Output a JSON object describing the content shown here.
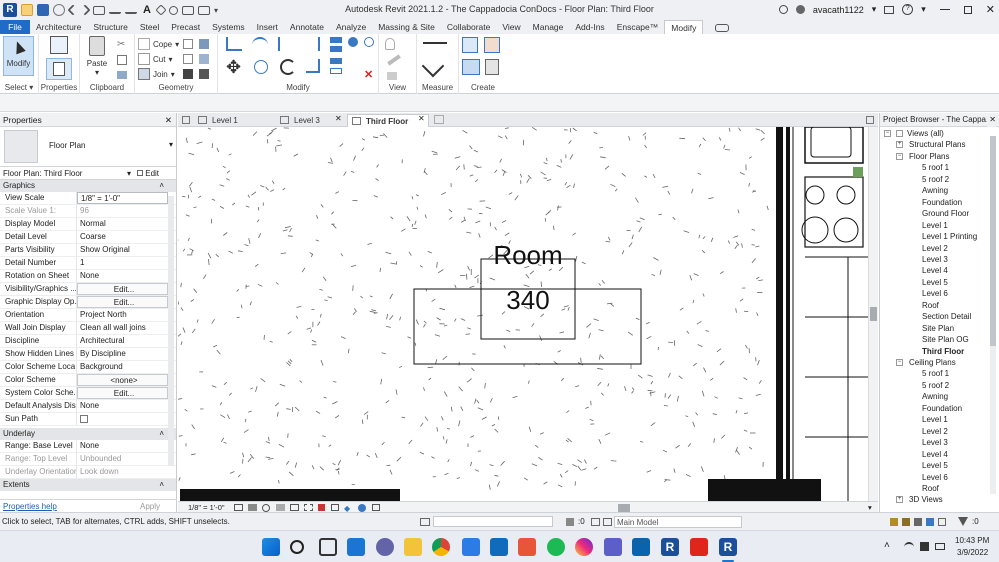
{
  "window": {
    "app_title": "Autodesk Revit 2021.1.2 - The Cappadocia ConDocs - Floor Plan: Third Floor",
    "username": "avacath1122",
    "help_glyph": "?"
  },
  "ribbon_tabs": [
    "File",
    "Architecture",
    "Structure",
    "Steel",
    "Precast",
    "Systems",
    "Insert",
    "Annotate",
    "Analyze",
    "Massing & Site",
    "Collaborate",
    "View",
    "Manage",
    "Add-Ins",
    "Enscape™",
    "Modify"
  ],
  "active_tab": "Modify",
  "ribbon": {
    "modify_label": "Modify",
    "select_label": "Select",
    "select_caret": "▾",
    "properties_label": "Properties",
    "paste_label": "Paste",
    "clipboard_label": "Clipboard",
    "cope_label": "Cope",
    "cut_label": "Cut",
    "join_label": "Join",
    "geometry_label": "Geometry",
    "modify_panel_label": "Modify",
    "view_label": "View",
    "measure_label": "Measure",
    "create_label": "Create"
  },
  "properties": {
    "header": "Properties",
    "close_glyph": "✕",
    "type_name": "Floor Plan",
    "selector": "Floor Plan: Third Floor",
    "edit_type": "Edit Type",
    "group_graphics": "Graphics",
    "group_underlay": "Underlay",
    "group_extents": "Extents",
    "rows": [
      {
        "k": "View Scale",
        "v": "1/8\" = 1'-0\""
      },
      {
        "k": "Scale Value    1:",
        "v": "96"
      },
      {
        "k": "Display Model",
        "v": "Normal"
      },
      {
        "k": "Detail Level",
        "v": "Coarse"
      },
      {
        "k": "Parts Visibility",
        "v": "Show Original"
      },
      {
        "k": "Detail Number",
        "v": "1"
      },
      {
        "k": "Rotation on Sheet",
        "v": "None"
      },
      {
        "k": "Visibility/Graphics ...",
        "v": "Edit..."
      },
      {
        "k": "Graphic Display Op...",
        "v": "Edit..."
      },
      {
        "k": "Orientation",
        "v": "Project North"
      },
      {
        "k": "Wall Join Display",
        "v": "Clean all wall joins"
      },
      {
        "k": "Discipline",
        "v": "Architectural"
      },
      {
        "k": "Show Hidden Lines",
        "v": "By Discipline"
      },
      {
        "k": "Color Scheme Loca...",
        "v": "Background"
      },
      {
        "k": "Color Scheme",
        "v": "<none>"
      },
      {
        "k": "System Color Sche...",
        "v": "Edit..."
      },
      {
        "k": "Default Analysis Dis...",
        "v": "None"
      },
      {
        "k": "Sun Path",
        "v": ""
      }
    ],
    "underlay_rows": [
      {
        "k": "Range: Base Level",
        "v": "None"
      },
      {
        "k": "Range: Top Level",
        "v": "Unbounded"
      },
      {
        "k": "Underlay Orientation",
        "v": "Look down"
      }
    ],
    "help_link": "Properties help",
    "apply_label": "Apply"
  },
  "view_tabs": [
    {
      "label": "Level 1"
    },
    {
      "label": "Level 3"
    },
    {
      "label": "Third Floor"
    }
  ],
  "active_view_tab": "Third Floor",
  "canvas": {
    "room_name": "Room",
    "room_number": "340"
  },
  "view_bar": {
    "scale": "1/8\" = 1'-0\""
  },
  "project_browser": {
    "header": "Project Browser - The Cappa...",
    "views_all": "Views (all)",
    "structural_plans": "Structural Plans",
    "floor_plans": "Floor Plans",
    "floor_plan_items": [
      "5 roof 1",
      "5 roof 2",
      "Awning",
      "Foundation",
      "Ground Floor",
      "Level 1",
      "Level 1 Printing",
      "Level 2",
      "Level 3",
      "Level 4",
      "Level 5",
      "Level 6",
      "Roof",
      "Section Detail",
      "Site Plan",
      "Site Plan OG",
      "Third Floor"
    ],
    "ceiling_plans": "Ceiling Plans",
    "ceiling_plan_items": [
      "5 roof 1",
      "5 roof 2",
      "Awning",
      "Foundation",
      "Level 1",
      "Level 2",
      "Level 3",
      "Level 4",
      "Level 5",
      "Level 6",
      "Roof"
    ],
    "views_3d": "3D Views",
    "active_item": "Third Floor"
  },
  "status": {
    "message": "Click to select, TAB for alternates, CTRL adds, SHIFT unselects.",
    "selection_count": ":0",
    "model": "Main Model"
  },
  "taskbar": {
    "time": "10:43 PM",
    "date": "3/9/2022"
  },
  "colors": {
    "file_tab": "#1f6bc8",
    "revit_blue": "#1b4f9a",
    "ribbon_icon_blue": "#3a78c4"
  }
}
